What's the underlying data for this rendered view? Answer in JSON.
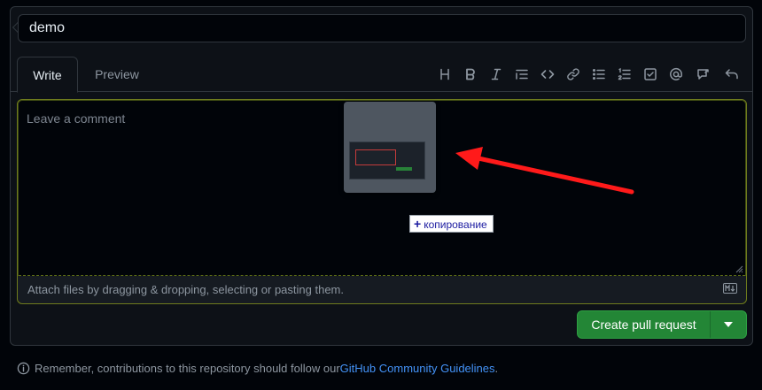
{
  "title_field": {
    "value": "demo"
  },
  "tabs": [
    {
      "label": "Write",
      "active": true
    },
    {
      "label": "Preview",
      "active": false
    }
  ],
  "toolbar": {
    "icons": [
      "heading-icon",
      "bold-icon",
      "italic-icon",
      "quote-icon",
      "code-icon",
      "link-icon",
      "unordered-list-icon",
      "ordered-list-icon",
      "task-list-icon",
      "mention-icon",
      "reference-icon",
      "undo-icon"
    ]
  },
  "editor": {
    "placeholder": "Leave a comment",
    "attach_hint": "Attach files by dragging & dropping, selecting or pasting them."
  },
  "drag_tooltip": {
    "label": "копирование"
  },
  "actions": {
    "create_label": "Create pull request"
  },
  "footer": {
    "prefix": "Remember, contributions to this repository should follow our ",
    "link_text": "GitHub Community Guidelines",
    "suffix": "."
  },
  "colors": {
    "accent_green": "#238636",
    "link_blue": "#4493f8",
    "focus_border": "#6e7b1d",
    "annotation_arrow": "#ff1a1a"
  }
}
